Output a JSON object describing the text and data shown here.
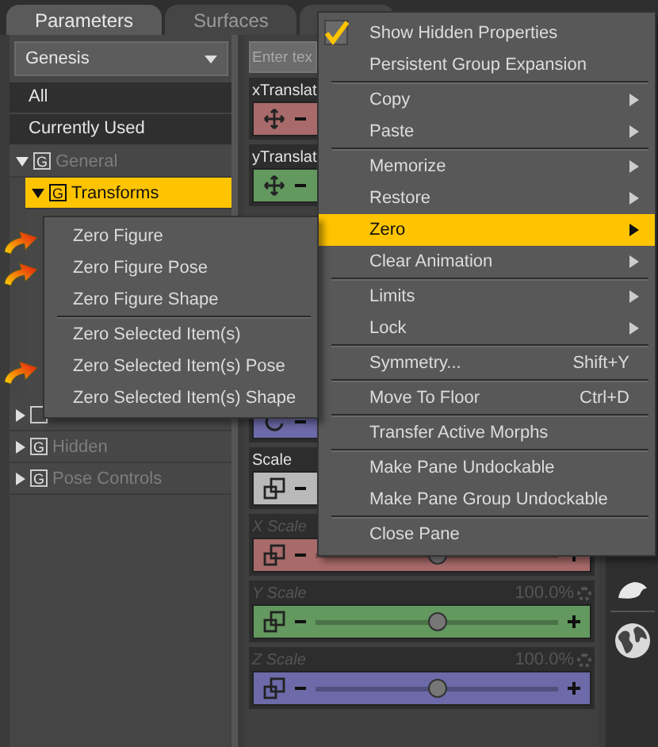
{
  "tabs": [
    {
      "label": "Parameters",
      "selected": true
    },
    {
      "label": "Surfaces",
      "selected": false
    }
  ],
  "figure_select": {
    "value": "Genesis"
  },
  "filters": [
    {
      "label": "All",
      "selected": false
    },
    {
      "label": "Currently Used",
      "selected": false
    }
  ],
  "tree": [
    {
      "label": "General",
      "badge": "G",
      "disabled": true,
      "expanded": true,
      "children": [
        {
          "label": "Transforms",
          "badge": "G",
          "selected": true,
          "expanded": true
        }
      ]
    },
    {
      "expanded": false
    },
    {
      "label": "Hidden",
      "badge": "G",
      "disabled": true,
      "expanded": false
    },
    {
      "label": "Pose Controls",
      "badge": "G",
      "disabled": true,
      "expanded": false
    }
  ],
  "search": {
    "placeholder": "Enter tex"
  },
  "parameters": [
    {
      "label": "xTranslat",
      "kind": "move",
      "color": "#a86a6a",
      "disabled": false
    },
    {
      "label": "yTranslat",
      "kind": "move",
      "color": "#63985f",
      "disabled": false
    },
    {
      "kind": "rotate",
      "color": "#6c6aa8"
    },
    {
      "label": "Scale",
      "kind": "scale",
      "color": "#b9b9b9",
      "disabled": false
    },
    {
      "label": "X Scale",
      "kind": "scale",
      "color": "#a86a6a",
      "disabled": true,
      "level": 0.5
    },
    {
      "label": "Y Scale",
      "value": "100.0%",
      "kind": "scale",
      "color": "#63985f",
      "disabled": true,
      "level": 0.5
    },
    {
      "label": "Z Scale",
      "value": "100.0%",
      "kind": "scale",
      "color": "#6c6aa8",
      "disabled": true,
      "level": 0.5
    }
  ],
  "context_menu": [
    {
      "label": "Show Hidden Properties",
      "checked": true
    },
    {
      "label": "Persistent Group Expansion",
      "checked": false
    },
    {
      "kind": "separator"
    },
    {
      "label": "Copy",
      "submenu": true
    },
    {
      "label": "Paste",
      "submenu": true
    },
    {
      "kind": "separator"
    },
    {
      "label": "Memorize",
      "submenu": true
    },
    {
      "label": "Restore",
      "submenu": true
    },
    {
      "label": "Zero",
      "submenu": true,
      "selected": true
    },
    {
      "label": "Clear Animation",
      "submenu": true
    },
    {
      "kind": "separator"
    },
    {
      "label": "Limits",
      "submenu": true
    },
    {
      "label": "Lock",
      "submenu": true
    },
    {
      "kind": "separator"
    },
    {
      "label": "Symmetry...",
      "shortcut": "Shift+Y"
    },
    {
      "kind": "separator"
    },
    {
      "label": "Move To Floor",
      "shortcut": "Ctrl+D"
    },
    {
      "kind": "separator"
    },
    {
      "label": "Transfer Active Morphs"
    },
    {
      "kind": "separator"
    },
    {
      "label": "Make Pane Undockable"
    },
    {
      "label": "Make Pane Group Undockable"
    },
    {
      "kind": "separator"
    },
    {
      "label": "Close Pane"
    }
  ],
  "zero_submenu": [
    {
      "label": "Zero Figure",
      "pointed": true
    },
    {
      "label": "Zero Figure Pose",
      "pointed": true
    },
    {
      "label": "Zero Figure Shape"
    },
    {
      "kind": "separator"
    },
    {
      "label": "Zero Selected Item(s)"
    },
    {
      "label": "Zero Selected Item(s) Pose",
      "pointed": true
    },
    {
      "label": "Zero Selected Item(s) Shape"
    }
  ]
}
